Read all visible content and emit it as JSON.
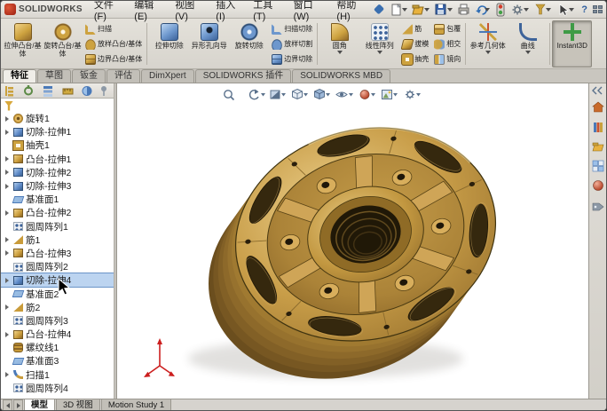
{
  "titlebar": {
    "logo_text": "SOLIDWORKS",
    "menus": [
      "文件(F)",
      "编辑(E)",
      "视图(V)",
      "插入(I)",
      "工具(T)",
      "窗口(W)",
      "帮助(H)"
    ],
    "quick_tool_icons": [
      "new-document-icon",
      "open-icon",
      "save-icon",
      "print-icon",
      "undo-icon",
      "rebuild-icon",
      "options-icon"
    ],
    "right_icons": [
      "select-arrow-icon",
      "help-icon",
      "window-layout-icon"
    ]
  },
  "ribbon": {
    "tabs": [
      {
        "label": "特征",
        "active": true
      },
      {
        "label": "草图",
        "active": false
      },
      {
        "label": "钣金",
        "active": false
      },
      {
        "label": "评估",
        "active": false
      },
      {
        "label": "DimXpert",
        "active": false
      },
      {
        "label": "SOLIDWORKS 插件",
        "active": false
      },
      {
        "label": "SOLIDWORKS MBD",
        "active": false
      }
    ],
    "buttons": [
      {
        "label": "拉伸凸台/基体",
        "icon": "extrude-boss-icon"
      },
      {
        "label": "旋转凸台/基体",
        "icon": "revolve-boss-icon"
      },
      {
        "label": "扫描",
        "icon": "swept-boss-icon"
      },
      {
        "label": "放样凸台/基体",
        "icon": "lofted-boss-icon"
      },
      {
        "label": "边界凸台/基体",
        "icon": "boundary-boss-icon"
      },
      {
        "label": "拉伸切除",
        "icon": "extruded-cut-icon"
      },
      {
        "label": "异形孔向导",
        "icon": "hole-wizard-icon"
      },
      {
        "label": "旋转切除",
        "icon": "revolved-cut-icon"
      },
      {
        "label": "扫描切除",
        "icon": "swept-cut-icon"
      },
      {
        "label": "放样切割",
        "icon": "lofted-cut-icon"
      },
      {
        "label": "边界切除",
        "icon": "boundary-cut-icon"
      },
      {
        "label": "圆角",
        "icon": "fillet-icon"
      },
      {
        "label": "线性阵列",
        "icon": "linear-pattern-icon"
      },
      {
        "label": "筋",
        "icon": "rib-icon"
      },
      {
        "label": "拔模",
        "icon": "draft-icon"
      },
      {
        "label": "抽壳",
        "icon": "shell-icon"
      },
      {
        "label": "包覆",
        "icon": "wrap-icon"
      },
      {
        "label": "相交",
        "icon": "intersect-icon"
      },
      {
        "label": "镜向",
        "icon": "mirror-icon"
      },
      {
        "label": "参考几何体",
        "icon": "reference-geometry-icon"
      },
      {
        "label": "曲线",
        "icon": "curves-icon"
      },
      {
        "label": "Instant3D",
        "icon": "instant3d-icon",
        "pressed": true
      }
    ]
  },
  "headsup": {
    "icons": [
      "zoom-fit-icon",
      "previous-view-icon",
      "section-view-icon",
      "view-orientation-icon",
      "display-style-icon",
      "hide-show-items-icon",
      "edit-appearance-icon",
      "apply-scene-icon",
      "view-settings-icon"
    ]
  },
  "tree": {
    "items": [
      {
        "label": "旋转1",
        "icon": "revolve-feature-icon"
      },
      {
        "label": "切除-拉伸1",
        "icon": "cut-extrude-feature-icon"
      },
      {
        "label": "抽壳1",
        "icon": "shell-feature-icon"
      },
      {
        "label": "凸台-拉伸1",
        "icon": "boss-extrude-feature-icon"
      },
      {
        "label": "切除-拉伸2",
        "icon": "cut-extrude-feature-icon"
      },
      {
        "label": "切除-拉伸3",
        "icon": "cut-extrude-feature-icon"
      },
      {
        "label": "基准面1",
        "icon": "plane-feature-icon"
      },
      {
        "label": "凸台-拉伸2",
        "icon": "boss-extrude-feature-icon"
      },
      {
        "label": "圆周阵列1",
        "icon": "circular-pattern-feature-icon"
      },
      {
        "label": "筋1",
        "icon": "rib-feature-icon"
      },
      {
        "label": "凸台-拉伸3",
        "icon": "boss-extrude-feature-icon"
      },
      {
        "label": "圆周阵列2",
        "icon": "circular-pattern-feature-icon"
      },
      {
        "label": "切除-拉伸4",
        "icon": "cut-extrude-feature-icon",
        "selected": true
      },
      {
        "label": "基准面2",
        "icon": "plane-feature-icon"
      },
      {
        "label": "筋2",
        "icon": "rib-feature-icon"
      },
      {
        "label": "圆周阵列3",
        "icon": "circular-pattern-feature-icon"
      },
      {
        "label": "凸台-拉伸4",
        "icon": "boss-extrude-feature-icon"
      },
      {
        "label": "螺纹线1",
        "icon": "helix-feature-icon"
      },
      {
        "label": "基准面3",
        "icon": "plane-feature-icon"
      },
      {
        "label": "扫描1",
        "icon": "sweep-feature-icon"
      },
      {
        "label": "圆周阵列4",
        "icon": "circular-pattern-feature-icon"
      }
    ],
    "selected_item": "切除-拉伸4"
  },
  "taskpane": {
    "icons": [
      "solidworks-resources-icon",
      "design-library-icon",
      "file-explorer-icon",
      "view-palette-icon",
      "appearances-icon",
      "custom-properties-icon"
    ]
  },
  "bottombar": {
    "tabs": [
      {
        "label": "模型",
        "active": true
      },
      {
        "label": "3D 视图",
        "active": false
      },
      {
        "label": "Motion Study 1",
        "active": false
      }
    ]
  },
  "model": {
    "body_color": "#c59a4a",
    "edge_color": "#3f3310",
    "background_color": "#ffffff"
  }
}
